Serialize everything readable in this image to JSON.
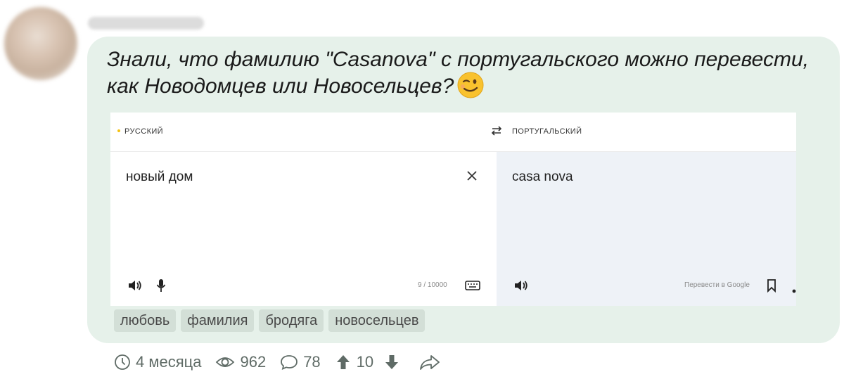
{
  "post": {
    "text_line1": "Знали, что фамилию \"Casanova\" с португальского можно перевести,",
    "text_line2": "как Новодомцев или Новосельцев?"
  },
  "translator": {
    "source_lang": "РУССКИЙ",
    "target_lang": "ПОРТУГАЛЬСКИЙ",
    "source_text": "новый дом",
    "target_text": "casa nova",
    "char_counter": "9 / 10000",
    "google_link": "Перевести в Google"
  },
  "tags": [
    "любовь",
    "фамилия",
    "бродяга",
    "новосельцев"
  ],
  "stats": {
    "age": "4 месяца",
    "views": "962",
    "comments": "78",
    "rating": "10"
  }
}
